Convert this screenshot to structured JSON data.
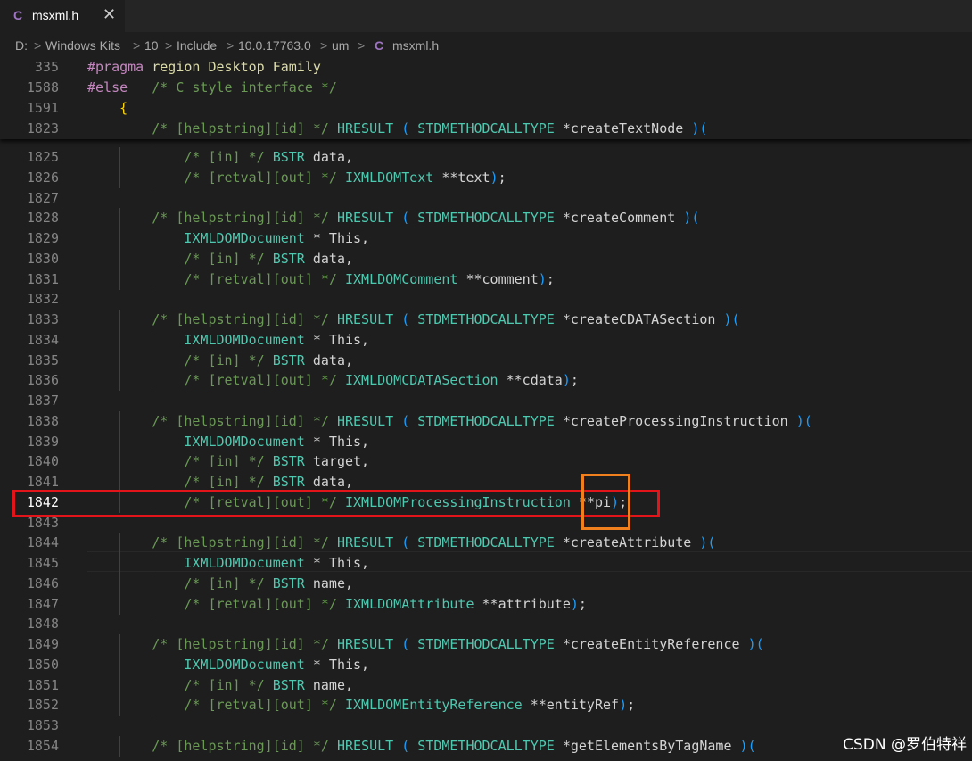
{
  "tab": {
    "icon": "C",
    "title": "msxml.h",
    "close": "✕"
  },
  "breadcrumb": {
    "items": [
      "D:",
      "Windows Kits",
      "10",
      "Include",
      "10.0.17763.0",
      "um"
    ],
    "separator": ">",
    "file_icon": "C",
    "file": "msxml.h"
  },
  "sticky": [
    {
      "ln": "335",
      "text": "#pragma region Desktop Family"
    },
    {
      "ln": "1588",
      "text": "#else   /* C style interface */"
    },
    {
      "ln": "1591",
      "text": "    {"
    },
    {
      "ln": "1823",
      "text": "        /* [helpstring][id] */ HRESULT ( STDMETHODCALLTYPE *createTextNode )("
    }
  ],
  "lines": [
    {
      "ln": "1825",
      "text": "            /* [in] */ BSTR data,"
    },
    {
      "ln": "1826",
      "text": "            /* [retval][out] */ IXMLDOMText **text);"
    },
    {
      "ln": "1827",
      "text": ""
    },
    {
      "ln": "1828",
      "text": "        /* [helpstring][id] */ HRESULT ( STDMETHODCALLTYPE *createComment )("
    },
    {
      "ln": "1829",
      "text": "            IXMLDOMDocument * This,"
    },
    {
      "ln": "1830",
      "text": "            /* [in] */ BSTR data,"
    },
    {
      "ln": "1831",
      "text": "            /* [retval][out] */ IXMLDOMComment **comment);"
    },
    {
      "ln": "1832",
      "text": ""
    },
    {
      "ln": "1833",
      "text": "        /* [helpstring][id] */ HRESULT ( STDMETHODCALLTYPE *createCDATASection )("
    },
    {
      "ln": "1834",
      "text": "            IXMLDOMDocument * This,"
    },
    {
      "ln": "1835",
      "text": "            /* [in] */ BSTR data,"
    },
    {
      "ln": "1836",
      "text": "            /* [retval][out] */ IXMLDOMCDATASection **cdata);"
    },
    {
      "ln": "1837",
      "text": ""
    },
    {
      "ln": "1838",
      "text": "        /* [helpstring][id] */ HRESULT ( STDMETHODCALLTYPE *createProcessingInstruction )("
    },
    {
      "ln": "1839",
      "text": "            IXMLDOMDocument * This,"
    },
    {
      "ln": "1840",
      "text": "            /* [in] */ BSTR target,"
    },
    {
      "ln": "1841",
      "text": "            /* [in] */ BSTR data,"
    },
    {
      "ln": "1842",
      "text": "            /* [retval][out] */ IXMLDOMProcessingInstruction **pi);"
    },
    {
      "ln": "1843",
      "text": ""
    },
    {
      "ln": "1844",
      "text": "        /* [helpstring][id] */ HRESULT ( STDMETHODCALLTYPE *createAttribute )("
    },
    {
      "ln": "1845",
      "text": "            IXMLDOMDocument * This,"
    },
    {
      "ln": "1846",
      "text": "            /* [in] */ BSTR name,"
    },
    {
      "ln": "1847",
      "text": "            /* [retval][out] */ IXMLDOMAttribute **attribute);"
    },
    {
      "ln": "1848",
      "text": ""
    },
    {
      "ln": "1849",
      "text": "        /* [helpstring][id] */ HRESULT ( STDMETHODCALLTYPE *createEntityReference )("
    },
    {
      "ln": "1850",
      "text": "            IXMLDOMDocument * This,"
    },
    {
      "ln": "1851",
      "text": "            /* [in] */ BSTR name,"
    },
    {
      "ln": "1852",
      "text": "            /* [retval][out] */ IXMLDOMEntityReference **entityRef);"
    },
    {
      "ln": "1853",
      "text": ""
    },
    {
      "ln": "1854",
      "text": "        /* [helpstring][id] */ HRESULT ( STDMETHODCALLTYPE *getElementsByTagName )("
    }
  ],
  "current_line": "1842",
  "watermark": "CSDN @罗伯特祥",
  "colors": {
    "background": "#1e1e1e",
    "comment": "#6a9955",
    "keyword": "#c586c0",
    "type": "#4ec9b0",
    "paren": "#179fff",
    "highlight_red": "#e3151a",
    "highlight_orange": "#f0801e"
  }
}
